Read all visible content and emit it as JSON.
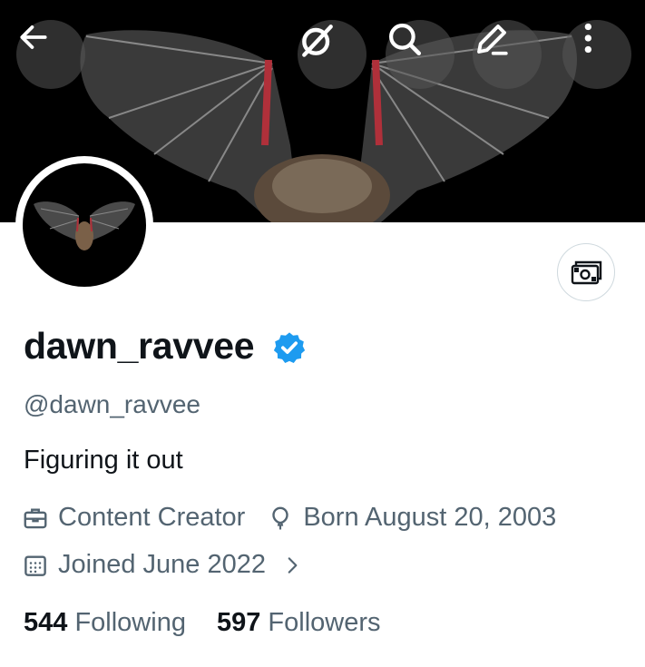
{
  "header": {
    "back_icon": "arrow-left-icon",
    "grok_icon": "grok-icon",
    "search_icon": "search-icon",
    "edit_icon": "edit-pencil-icon",
    "more_icon": "more-vertical-icon"
  },
  "profile": {
    "display_name": "dawn_ravvee",
    "handle": "@dawn_ravvee",
    "bio": "Figuring it out",
    "verified": true,
    "category": "Content Creator",
    "birthday": "Born August 20, 2003",
    "joined": "Joined June 2022"
  },
  "counts": {
    "following_count": "544",
    "following_label": "Following",
    "followers_count": "597",
    "followers_label": "Followers"
  },
  "colors": {
    "text_primary": "#0f1419",
    "text_secondary": "#536471",
    "verified_blue": "#1d9bf0",
    "border": "#cfd9de"
  }
}
